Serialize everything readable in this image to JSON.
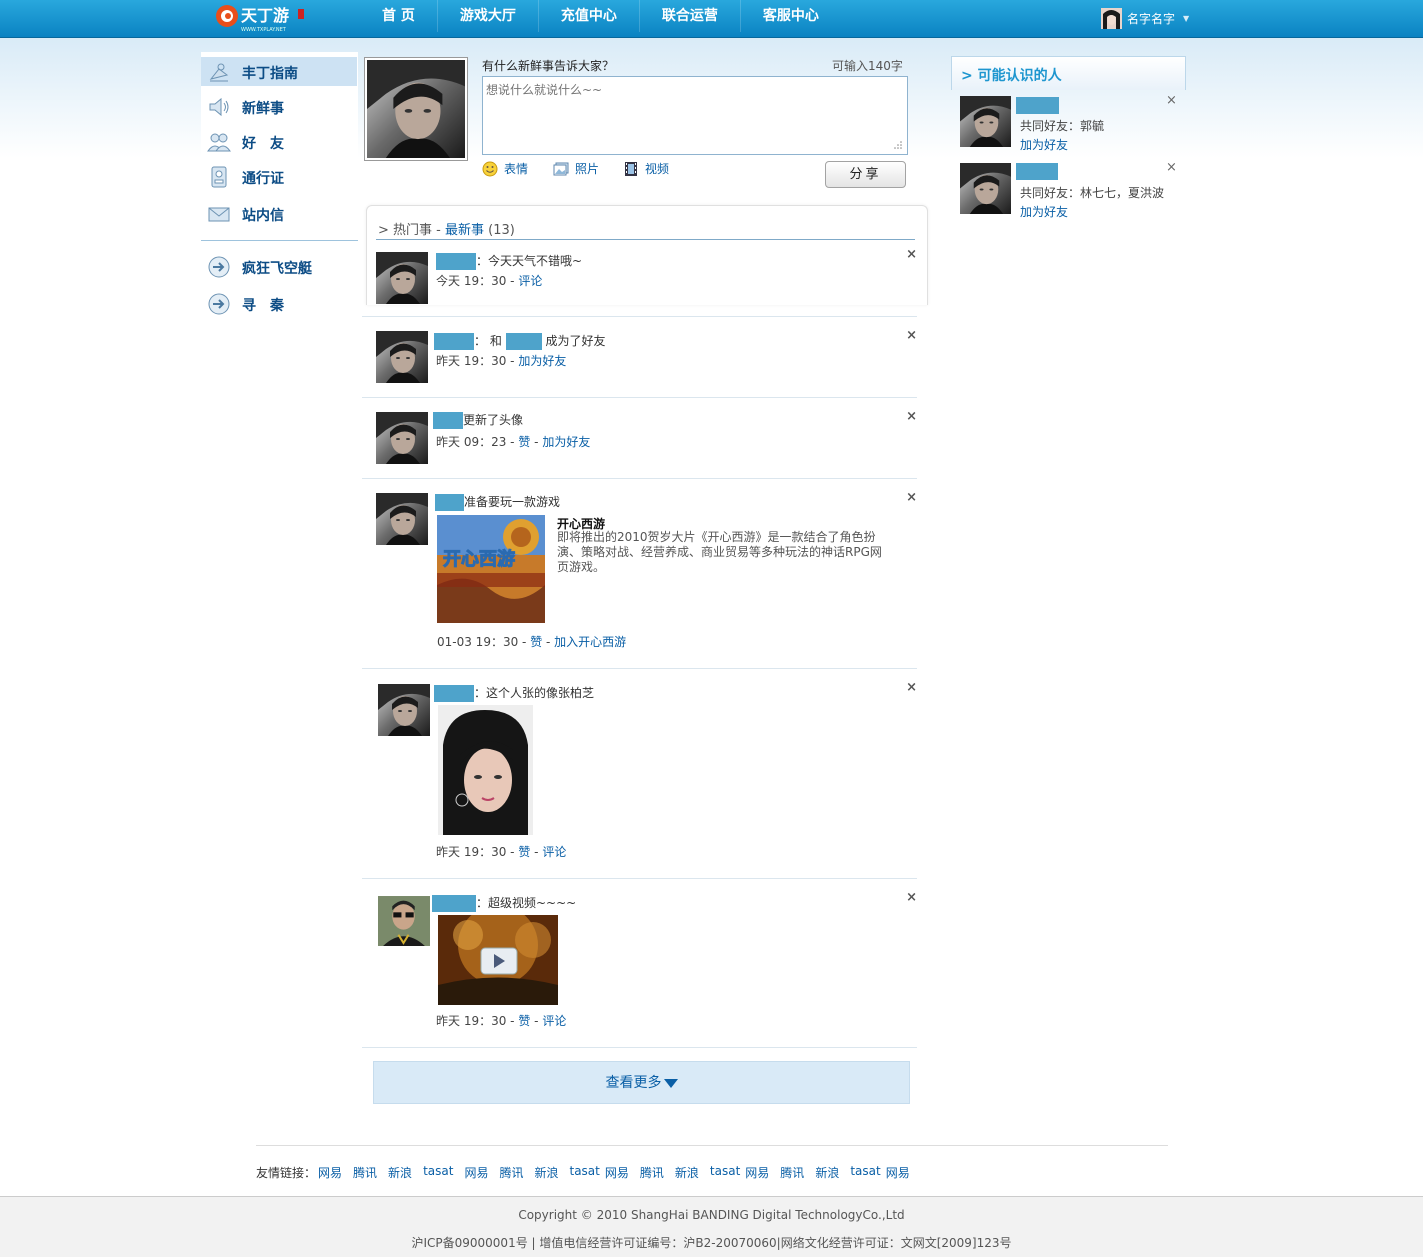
{
  "brand": {
    "logo_text": "天丁游",
    "logo_sub": "WWW.TXPLAY.NET"
  },
  "nav": {
    "items": [
      "首 页",
      "游戏大厅",
      "充值中心",
      "联合运营",
      "客服中心"
    ]
  },
  "user": {
    "name": "名字名字"
  },
  "sidebar": {
    "items": [
      {
        "label": "丰丁指南",
        "icon": "satellite-icon"
      },
      {
        "label": "新鲜事",
        "icon": "speaker-icon"
      },
      {
        "label": "好　友",
        "icon": "friends-icon"
      },
      {
        "label": "通行证",
        "icon": "id-card-icon"
      },
      {
        "label": "站内信",
        "icon": "mail-icon"
      }
    ],
    "apps": [
      {
        "label": "疯狂飞空艇",
        "icon": "arrow-circle-icon"
      },
      {
        "label": "寻　秦",
        "icon": "arrow-circle-icon"
      }
    ]
  },
  "composer": {
    "prompt": "有什么新鲜事告诉大家？",
    "remaining": "可输入140字",
    "placeholder": "想说什么就说什么~~",
    "tools": [
      "表情",
      "照片",
      "视频"
    ],
    "share_label": "分享"
  },
  "feed": {
    "tab_prefix": "> 热门事",
    "tab_sep": " - ",
    "tab_active": "最新事",
    "count": "(13)",
    "items": [
      {
        "text": "：今天天气不错哦~",
        "time": "今天 19：30 - ",
        "action": "评论"
      },
      {
        "text_pre": "：  和",
        "text_post": "成为了好友",
        "time": "昨天 19：30 - ",
        "action": "加为好友"
      },
      {
        "text": "更新了头像",
        "time": "昨天 09：23 - ",
        "like": "赞",
        "sep": " - ",
        "action": "加为好友"
      },
      {
        "text": "准备要玩一款游戏",
        "game_title": "开心西游",
        "game_desc": "即将推出的2010贺岁大片《开心西游》是一款结合了角色扮演、策略对战、经营养成、商业贸易等多种玩法的神话RPG网页游戏。",
        "time": "01-03 19：30 - ",
        "like": "赞",
        "sep": " - ",
        "action": "加入开心西游"
      },
      {
        "text": "：这个人张的像张柏芝",
        "time": "昨天 19：30 - ",
        "like": "赞",
        "sep": " - ",
        "action": "评论"
      },
      {
        "text": "：超级视频~~~~",
        "time": "昨天 19：30 - ",
        "like": "赞",
        "sep": " - ",
        "action": "评论"
      }
    ],
    "more_label": "查看更多"
  },
  "suggest": {
    "title": "> 可能认识的人",
    "people": [
      {
        "mutual": "共同好友：郭毓",
        "add": "加为好友"
      },
      {
        "mutual": "共同好友：林七七，夏洪波",
        "add": "加为好友"
      }
    ]
  },
  "links": {
    "label": "友情链接：",
    "items": [
      "网易",
      "腾讯",
      "新浪",
      "tasat",
      "网易",
      "腾讯",
      "新浪",
      "tasat",
      "网易",
      "腾讯",
      "新浪",
      "tasat",
      "网易",
      "腾讯",
      "新浪",
      "tasat",
      "网易"
    ]
  },
  "footer": {
    "copyright": "Copyright © 2010 ShangHai BANDING Digital TechnologyCo.,Ltd",
    "license": "沪ICP备09000001号 | 增值电信经营许可证编号：沪B2-20070060|网络文化经营许可证：文网文[2009]123号"
  },
  "colors": {
    "nav_bg": "#0a82c2",
    "accent": "#1e96cf",
    "link": "#0a5fa6",
    "username_block": "#4ea3cb"
  }
}
